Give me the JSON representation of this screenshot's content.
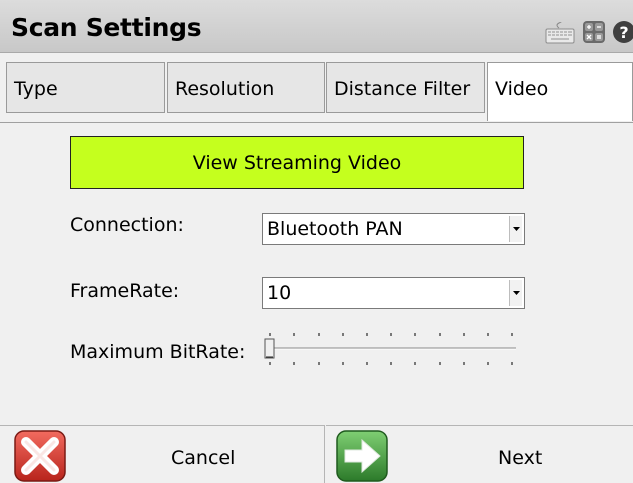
{
  "window": {
    "title": "Scan Settings"
  },
  "header_icons": [
    "keyboard-icon",
    "calculator-icon",
    "help-icon"
  ],
  "tabs": [
    {
      "label": "Type",
      "active": false
    },
    {
      "label": "Resolution",
      "active": false
    },
    {
      "label": "Distance Filter",
      "active": false
    },
    {
      "label": "Video",
      "active": true
    }
  ],
  "video": {
    "stream_button_label": "View Streaming Video",
    "connection": {
      "label": "Connection:",
      "value": "Bluetooth PAN"
    },
    "framerate": {
      "label": "FrameRate:",
      "value": "10"
    },
    "bitrate": {
      "label": "Maximum BitRate:",
      "slider_position": 0
    }
  },
  "footer": {
    "cancel_label": "Cancel",
    "next_label": "Next"
  },
  "colors": {
    "stream_button_bg": "#c5ff1e",
    "cancel_icon": "#d9332b",
    "next_icon": "#3e9a3a"
  }
}
